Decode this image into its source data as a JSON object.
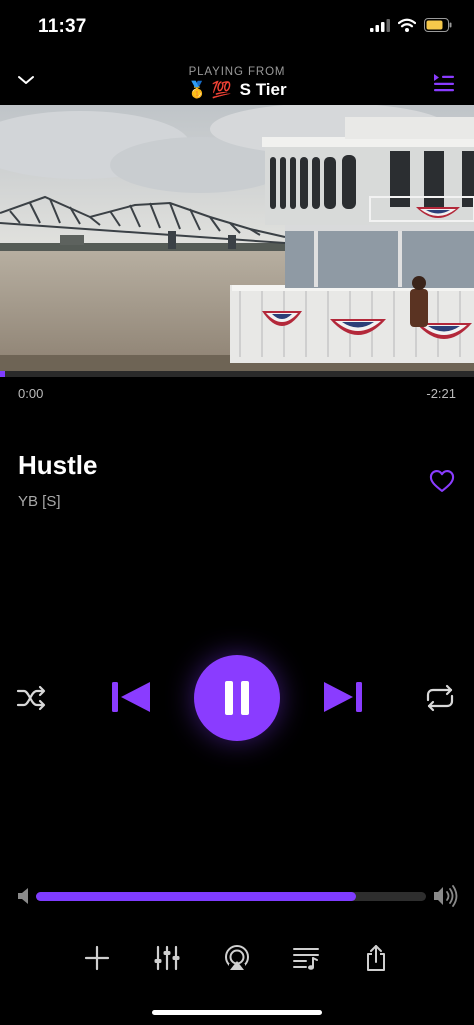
{
  "status_bar": {
    "time": "11:37",
    "icons": [
      "signal-icon",
      "wifi-icon",
      "battery-icon"
    ],
    "battery_color": "#f5c84b"
  },
  "header": {
    "playing_from_label": "PLAYING FROM",
    "playlist_emojis": "🥇 💯",
    "playlist_name": "S Tier",
    "accent": "#8a3cff"
  },
  "player": {
    "elapsed": "0:00",
    "remaining": "-2:21",
    "progress_fraction": 0.01,
    "title": "Hustle",
    "artist": "YB [S]",
    "is_playing": true
  },
  "controls": {
    "shuffle": "shuffle-icon",
    "previous": "skip-previous-icon",
    "play_pause": "pause-icon",
    "next": "skip-next-icon",
    "repeat": "repeat-icon"
  },
  "volume": {
    "level_fraction": 0.82
  },
  "actions": [
    "add-icon",
    "equalizer-icon",
    "airplay-icon",
    "lyrics-icon",
    "share-icon"
  ]
}
